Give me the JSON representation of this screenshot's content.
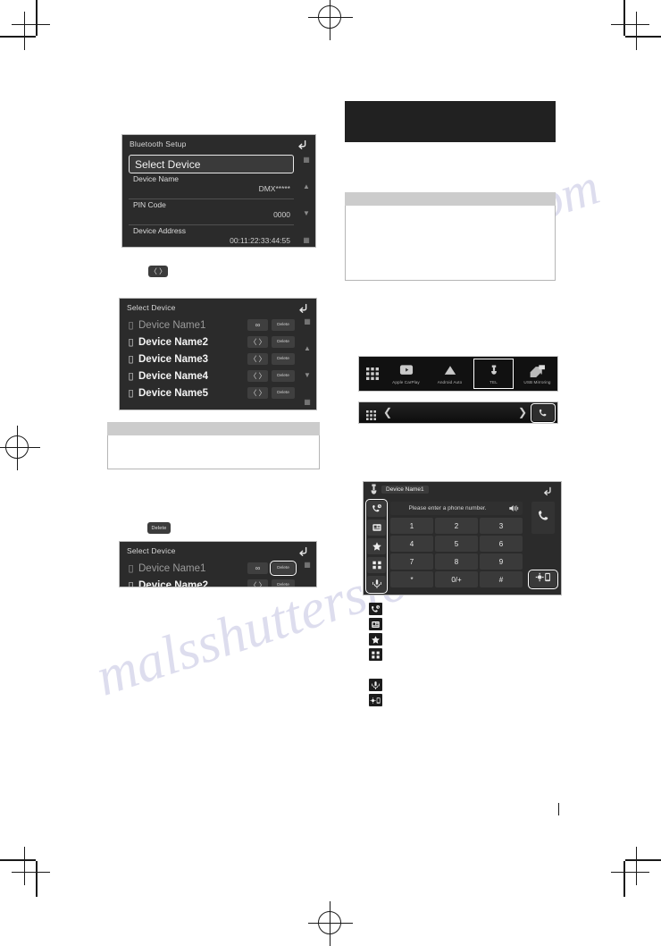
{
  "bluetooth_setup": {
    "title": "Bluetooth Setup",
    "select_device_label": "Select Device",
    "rows": [
      {
        "key": "Device Name",
        "value": "DMX*****"
      },
      {
        "key": "PIN Code",
        "value": "0000"
      },
      {
        "key": "Device Address",
        "value": "00:11:22:33:44:55"
      }
    ],
    "back_icon": "back-arrow-icon",
    "scroll": [
      "scroll-top-icon",
      "scroll-up-icon",
      "scroll-down-icon",
      "scroll-bottom-icon"
    ]
  },
  "connect_button": {
    "icon": "connect-brackets-icon",
    "glyph": "〈 〉"
  },
  "select_device": {
    "title": "Select Device",
    "devices": [
      {
        "name": "Device Name1",
        "state": "connected",
        "conn_glyph": "∞",
        "delete_label": "Delete"
      },
      {
        "name": "Device Name2",
        "state": "disconnected",
        "conn_glyph": "〈 〉",
        "delete_label": "Delete"
      },
      {
        "name": "Device Name3",
        "state": "disconnected",
        "conn_glyph": "〈 〉",
        "delete_label": "Delete"
      },
      {
        "name": "Device Name4",
        "state": "disconnected",
        "conn_glyph": "〈 〉",
        "delete_label": "Delete"
      },
      {
        "name": "Device Name5",
        "state": "disconnected",
        "conn_glyph": "〈 〉",
        "delete_label": "Delete"
      }
    ]
  },
  "delete_button": {
    "label": "Delete"
  },
  "select_device_delete": {
    "title": "Select Device",
    "devices": [
      {
        "name": "Device Name1",
        "state": "connected",
        "conn_glyph": "∞",
        "delete_label": "Delete"
      },
      {
        "name": "Device Name2",
        "state": "disconnected",
        "conn_glyph": "〈 〉",
        "delete_label": "Delete"
      }
    ]
  },
  "source_bar": {
    "grid_icon": "apps-grid-icon",
    "items": [
      {
        "label": "Apple CarPlay",
        "icon": "apple-carplay-icon",
        "active": false
      },
      {
        "label": "Android Auto",
        "icon": "android-auto-icon",
        "active": false
      },
      {
        "label": "TEL",
        "icon": "telephone-icon",
        "active": true
      },
      {
        "label": "USB Mirroring",
        "icon": "usb-mirroring-icon",
        "active": false
      }
    ]
  },
  "thin_bar": {
    "grid_icon": "apps-grid-icon",
    "prev_icon": "chevron-left-icon",
    "next_icon": "chevron-right-icon",
    "phone_icon": "phone-handset-icon"
  },
  "phone_screen": {
    "device_name": "Device Name1",
    "signal_icon": "signal-strength-icon",
    "battery_text": "",
    "back_icon": "back-arrow-icon",
    "entry_placeholder": "Please enter a phone number.",
    "speaker_icon": "speaker-icon",
    "side_buttons": [
      {
        "icon": "call-history-icon"
      },
      {
        "icon": "phonebook-icon"
      },
      {
        "icon": "favorites-star-icon"
      },
      {
        "icon": "keypad-icon"
      },
      {
        "icon": "voice-recognition-icon"
      }
    ],
    "keys": [
      "1",
      "2",
      "3",
      "4",
      "5",
      "6",
      "7",
      "8",
      "9",
      "*",
      "0/+",
      "#"
    ],
    "call_icon": "call-handset-icon",
    "settings_icon": "device-settings-icon"
  },
  "legend": {
    "group_a": [
      {
        "icon": "call-history-icon"
      },
      {
        "icon": "phonebook-icon"
      },
      {
        "icon": "favorites-star-icon"
      },
      {
        "icon": "keypad-icon"
      }
    ],
    "group_b": [
      {
        "icon": "voice-recognition-icon"
      },
      {
        "icon": "device-settings-icon"
      }
    ]
  },
  "watermark": {
    "line1": "malsshutterstock",
    "line2": ".com"
  }
}
